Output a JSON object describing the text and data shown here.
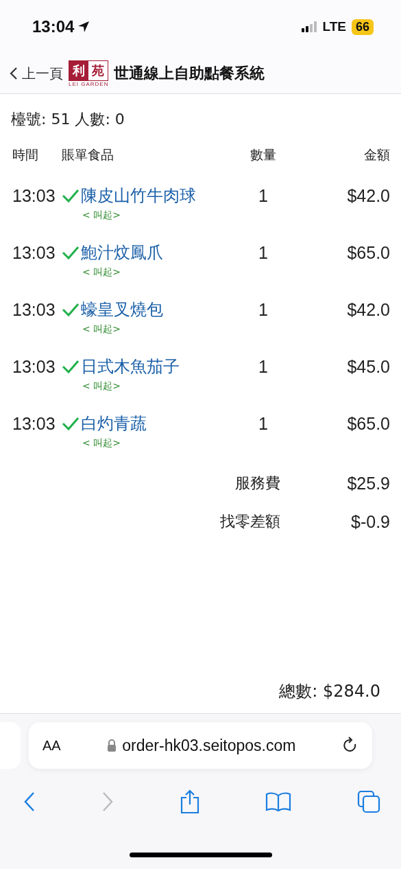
{
  "status_bar": {
    "time": "13:04",
    "network": "LTE",
    "battery": "66"
  },
  "header": {
    "back_label": "上一頁",
    "logo": {
      "left": "利",
      "right": "苑",
      "caption": "LEI GARDEN"
    },
    "title": "世通線上自助點餐系統"
  },
  "table_info": "檯號: 51 人數: 0",
  "columns": [
    "時間",
    "賬單食品",
    "數量",
    "金額"
  ],
  "orders": [
    {
      "time": "13:03",
      "confirmed": true,
      "item": "陳皮山竹牛肉球",
      "action": "< 叫起>",
      "qty": "1",
      "amount": "$42.0"
    },
    {
      "time": "13:03",
      "confirmed": true,
      "item": "鮑汁炆鳳爪",
      "action": "< 叫起>",
      "qty": "1",
      "amount": "$65.0"
    },
    {
      "time": "13:03",
      "confirmed": true,
      "item": "蠔皇叉燒包",
      "action": "< 叫起>",
      "qty": "1",
      "amount": "$42.0"
    },
    {
      "time": "13:03",
      "confirmed": true,
      "item": "日式木魚茄子",
      "action": "< 叫起>",
      "qty": "1",
      "amount": "$45.0"
    },
    {
      "time": "13:03",
      "confirmed": true,
      "item": "白灼青蔬",
      "action": "< 叫起>",
      "qty": "1",
      "amount": "$65.0"
    }
  ],
  "charges": [
    {
      "label": "服務費",
      "amount": "$25.9"
    },
    {
      "label": "找零差額",
      "amount": "$-0.9"
    }
  ],
  "total": "總數: $284.0",
  "browser": {
    "text_size": "AA",
    "url": "order-hk03.seitopos.com",
    "back_enabled": true,
    "forward_enabled": false
  }
}
